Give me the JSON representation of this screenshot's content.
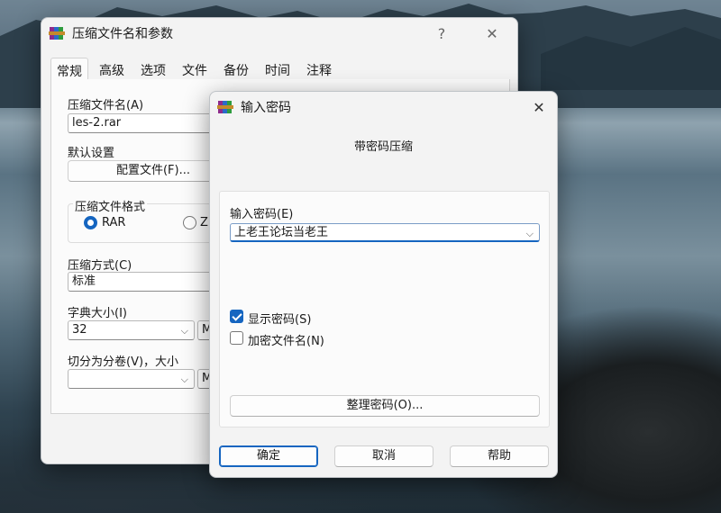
{
  "main": {
    "title": "压缩文件名和参数",
    "help": "?",
    "close": "✕",
    "tabs": [
      "常规",
      "高级",
      "选项",
      "文件",
      "备份",
      "时间",
      "注释"
    ],
    "archive_name_label": "压缩文件名(A)",
    "archive_name_value": "les-2.rar",
    "default_settings_label": "默认设置",
    "profiles_button": "配置文件(F)...",
    "format_group_label": "压缩文件格式",
    "format_rar": "RAR",
    "format_zip": "ZI",
    "method_label": "压缩方式(C)",
    "method_value": "标准",
    "dict_label": "字典大小(I)",
    "dict_value": "32",
    "dict_unit": "M",
    "split_label": "切分为分卷(V)，大小",
    "split_value": "",
    "split_unit": "M"
  },
  "dialog": {
    "title": "输入密码",
    "close": "✕",
    "heading": "带密码压缩",
    "password_label": "输入密码(E)",
    "password_value": "上老王论坛当老王",
    "show_password": "显示密码(S)",
    "show_password_checked": true,
    "encrypt_names": "加密文件名(N)",
    "encrypt_names_checked": false,
    "organize_button": "整理密码(O)...",
    "ok": "确定",
    "cancel": "取消",
    "help": "帮助"
  },
  "colors": {
    "accent": "#1565c0",
    "window_bg": "#f3f3f3"
  },
  "icons": {
    "app": "winrar-icon",
    "dropdown": "chevron-down-icon"
  }
}
